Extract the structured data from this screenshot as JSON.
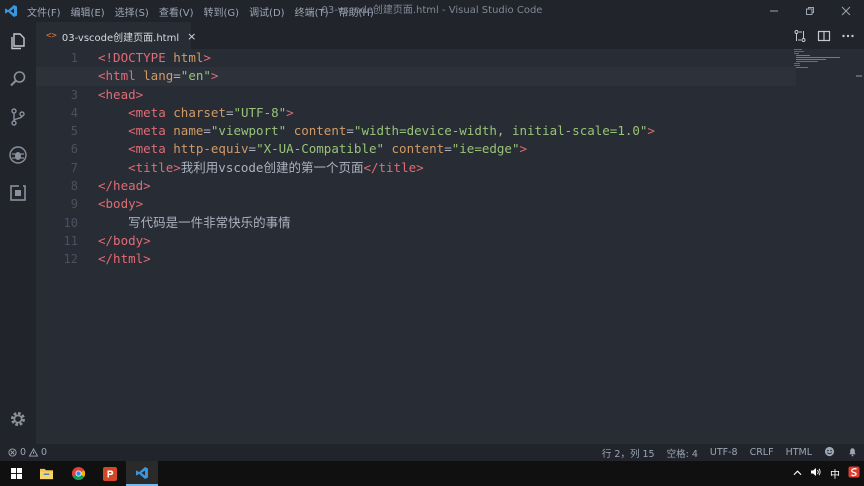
{
  "window": {
    "title": "03-vscode创建页面.html - Visual Studio Code",
    "menu": [
      "文件(F)",
      "编辑(E)",
      "选择(S)",
      "查看(V)",
      "转到(G)",
      "调试(D)",
      "终端(T)",
      "帮助(H)"
    ]
  },
  "tab": {
    "icon_text": "<>",
    "label": "03-vscode创建页面.html",
    "close": "×"
  },
  "editor": {
    "active_line": 2,
    "line_numbers": [
      "1",
      "2",
      "3",
      "4",
      "5",
      "6",
      "7",
      "8",
      "9",
      "10",
      "11",
      "12"
    ],
    "lines": [
      [
        {
          "t": "<!DOCTYPE ",
          "c": "tag"
        },
        {
          "t": "html",
          "c": "attr"
        },
        {
          "t": ">",
          "c": "tag"
        }
      ],
      [
        {
          "t": "<html ",
          "c": "tag"
        },
        {
          "t": "lang",
          "c": "attr"
        },
        {
          "t": "=",
          "c": "punc"
        },
        {
          "t": "\"en\"",
          "c": "str"
        },
        {
          "t": ">",
          "c": "tag"
        }
      ],
      [
        {
          "t": "<head>",
          "c": "tag"
        }
      ],
      [
        {
          "t": "    ",
          "c": "txt"
        },
        {
          "t": "<meta ",
          "c": "tag"
        },
        {
          "t": "charset",
          "c": "attr"
        },
        {
          "t": "=",
          "c": "punc"
        },
        {
          "t": "\"UTF-8\"",
          "c": "str"
        },
        {
          "t": ">",
          "c": "tag"
        }
      ],
      [
        {
          "t": "    ",
          "c": "txt"
        },
        {
          "t": "<meta ",
          "c": "tag"
        },
        {
          "t": "name",
          "c": "attr"
        },
        {
          "t": "=",
          "c": "punc"
        },
        {
          "t": "\"viewport\"",
          "c": "str"
        },
        {
          "t": " ",
          "c": "txt"
        },
        {
          "t": "content",
          "c": "attr"
        },
        {
          "t": "=",
          "c": "punc"
        },
        {
          "t": "\"width=device-width, initial-scale=1.0\"",
          "c": "str"
        },
        {
          "t": ">",
          "c": "tag"
        }
      ],
      [
        {
          "t": "    ",
          "c": "txt"
        },
        {
          "t": "<meta ",
          "c": "tag"
        },
        {
          "t": "http-equiv",
          "c": "attr"
        },
        {
          "t": "=",
          "c": "punc"
        },
        {
          "t": "\"X-UA-Compatible\"",
          "c": "str"
        },
        {
          "t": " ",
          "c": "txt"
        },
        {
          "t": "content",
          "c": "attr"
        },
        {
          "t": "=",
          "c": "punc"
        },
        {
          "t": "\"ie=edge\"",
          "c": "str"
        },
        {
          "t": ">",
          "c": "tag"
        }
      ],
      [
        {
          "t": "    ",
          "c": "txt"
        },
        {
          "t": "<title>",
          "c": "tag"
        },
        {
          "t": "我利用vscode创建的第一个页面",
          "c": "txt"
        },
        {
          "t": "</title>",
          "c": "tag"
        }
      ],
      [
        {
          "t": "</head>",
          "c": "tag"
        }
      ],
      [
        {
          "t": "<body>",
          "c": "tag"
        }
      ],
      [
        {
          "t": "    写代码是一件非常快乐的事情",
          "c": "txt"
        }
      ],
      [
        {
          "t": "</body>",
          "c": "tag"
        }
      ],
      [
        {
          "t": "</html>",
          "c": "tag"
        }
      ]
    ]
  },
  "status": {
    "errors": "0",
    "warnings": "0",
    "position": "行 2，列 15",
    "spaces": "空格: 4",
    "encoding": "UTF-8",
    "eol": "CRLF",
    "language": "HTML"
  },
  "tray": {
    "ime": "中"
  },
  "colors": {
    "accent": "#528bff",
    "tag": "#e06c75",
    "attr": "#d19a66",
    "string": "#98c379"
  }
}
